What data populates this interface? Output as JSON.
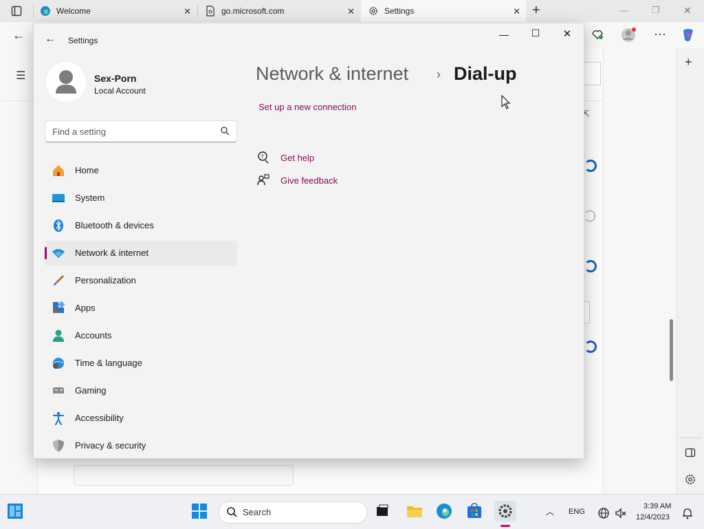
{
  "browser": {
    "tabs": [
      {
        "title": "Welcome",
        "close": "✕"
      },
      {
        "title": "go.microsoft.com",
        "close": "✕"
      },
      {
        "title": "Settings",
        "close": "✕"
      }
    ],
    "new_tab": "+",
    "win_min": "—",
    "win_restore": "❐",
    "win_close": "✕"
  },
  "settings": {
    "window_title": "Settings",
    "user": {
      "name": "Sex-Porn",
      "account": "Local Account"
    },
    "search_placeholder": "Find a setting",
    "nav": [
      {
        "label": "Home"
      },
      {
        "label": "System"
      },
      {
        "label": "Bluetooth & devices"
      },
      {
        "label": "Network & internet"
      },
      {
        "label": "Personalization"
      },
      {
        "label": "Apps"
      },
      {
        "label": "Accounts"
      },
      {
        "label": "Time & language"
      },
      {
        "label": "Gaming"
      },
      {
        "label": "Accessibility"
      },
      {
        "label": "Privacy & security"
      }
    ],
    "breadcrumb": {
      "section": "Network & internet",
      "separator": "›",
      "current": "Dial-up"
    },
    "setup_link": "Set up a new connection",
    "get_help": "Get help",
    "give_feedback": "Give feedback"
  },
  "taskbar": {
    "search_label": "Search",
    "language": "ENG",
    "time": "3:39 AM",
    "date": "12/4/2023"
  },
  "colors": {
    "accent": "#b0006e",
    "link": "#8a0a5a"
  }
}
